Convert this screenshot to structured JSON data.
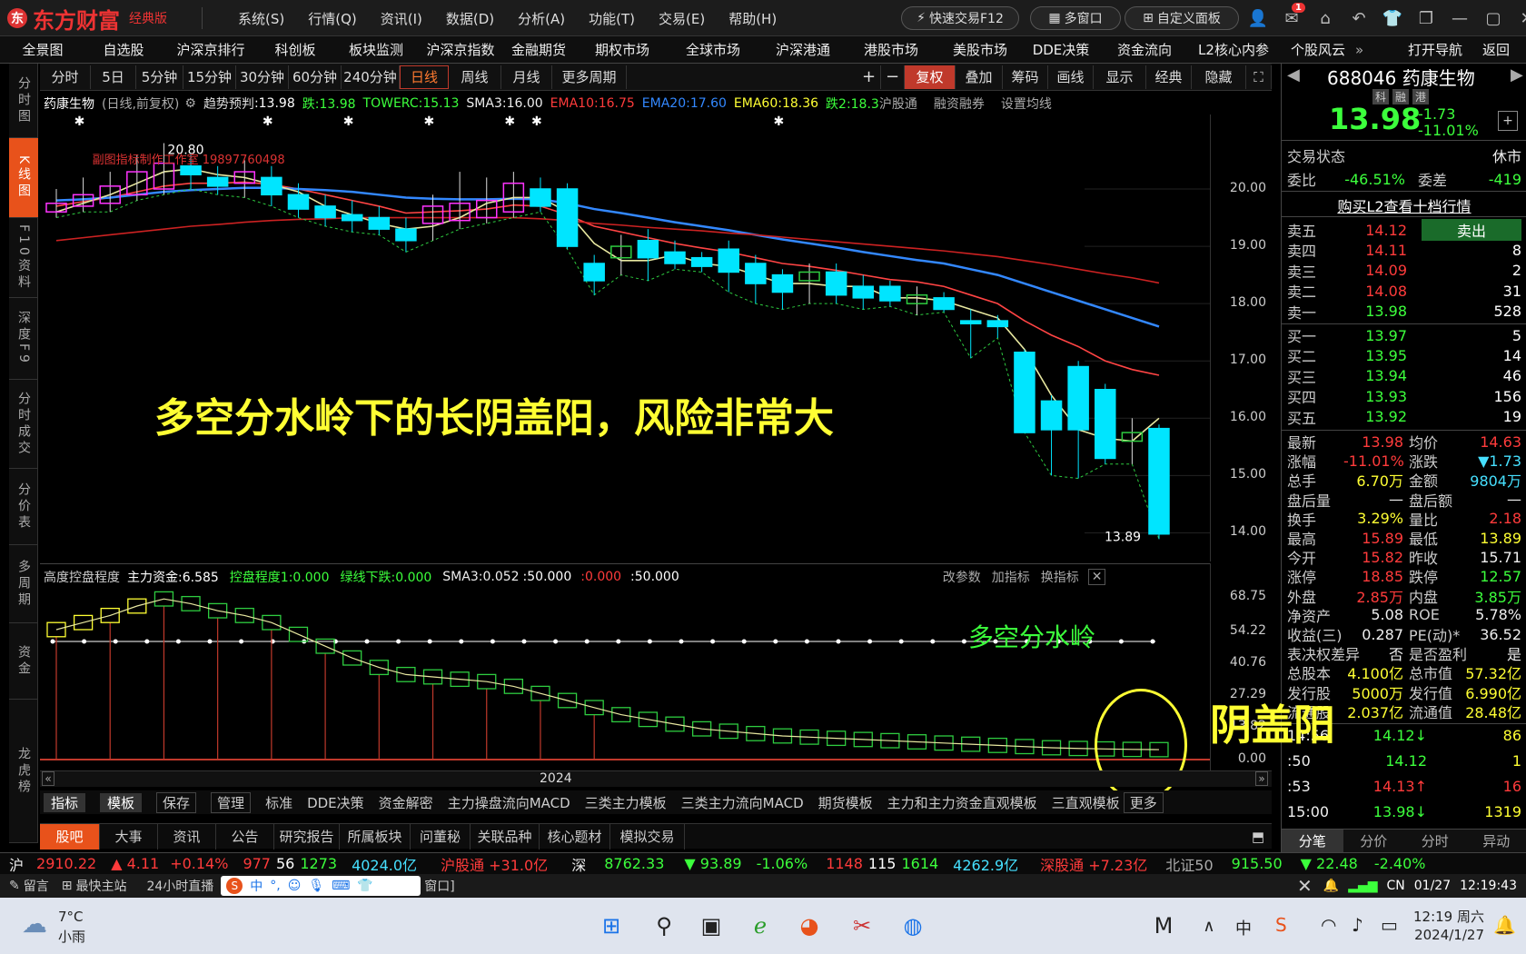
{
  "app": {
    "logo_text": "东方财富",
    "edition": "经典版"
  },
  "top_menu": [
    "系统(S)",
    "行情(Q)",
    "资讯(I)",
    "数据(D)",
    "分析(A)",
    "功能(T)",
    "交易(E)",
    "帮助(H)"
  ],
  "top_buttons": {
    "quick_trade": "快速交易F12",
    "multi_window": "多窗口",
    "custom_panel": "自定义面板"
  },
  "notification_count": "1",
  "nav": [
    "全景图",
    "自选股",
    "沪深京排行",
    "科创板",
    "板块监测",
    "沪深京指数",
    "金融期货",
    "期权市场",
    "全球市场",
    "沪深港通",
    "港股市场",
    "美股市场",
    "DDE决策",
    "资金流向",
    "L2核心内参",
    "个股风云"
  ],
  "nav_right": {
    "open_nav": "打开导航",
    "back": "返回"
  },
  "left_tabs": [
    {
      "label": "分时图",
      "active": false
    },
    {
      "label": "K线图",
      "active": true
    },
    {
      "label": "F10资料",
      "active": false
    },
    {
      "label": "深度F9",
      "active": false
    },
    {
      "label": "分时成交",
      "active": false
    },
    {
      "label": "分价表",
      "active": false
    },
    {
      "label": "多周期",
      "active": false
    },
    {
      "label": "资金",
      "active": false
    },
    {
      "label": "龙虎榜",
      "active": false
    }
  ],
  "period_tabs": [
    "分时",
    "5日",
    "5分钟",
    "15分钟",
    "30分钟",
    "60分钟",
    "240分钟",
    "日线",
    "周线",
    "月线",
    "更多周期"
  ],
  "period_active": "日线",
  "chart_tools": [
    "复权",
    "叠加",
    "筹码",
    "画线",
    "显示",
    "经典",
    "隐藏"
  ],
  "info_line": {
    "name": "药康生物",
    "mode": "(日线,前复权)",
    "trend": "趋势预判",
    "trend_val": ":13.98",
    "die": "跌:13.98",
    "towerc": "TOWERC:15.13",
    "sma3": "SMA3:16.00",
    "ema10": "EMA10:16.75",
    "ema20": "EMA20:17.60",
    "ema60": "EMA60:18.36",
    "die2": "跌2:18.3",
    "links": [
      "沪股通",
      "融资融券",
      "设置均线"
    ]
  },
  "annotation": "多空分水岭下的长阴盖阳，风险非常大",
  "chart_labels": {
    "high_mark": "20.80",
    "low_mark": "13.89",
    "watermark": "副图指标制作工作室 19897760498"
  },
  "y_axis_main": [
    "20.00",
    "19.00",
    "18.00",
    "17.00",
    "16.00",
    "15.00",
    "14.00"
  ],
  "sub_header": {
    "name": "高度控盘程度",
    "main_fund": "主力资金:6.585",
    "control": "控盘程度1:0.000",
    "green_down": "绿线下跌:0.000",
    "sma3": "SMA3:0.052",
    "v1": ":50.000",
    "v2": ":0.000",
    "v3": ":50.000",
    "btns": [
      "改参数",
      "加指标",
      "换指标"
    ]
  },
  "sub_annotation": "多空分水岭",
  "yin_label": "阴盖阳",
  "y_axis_sub": [
    "68.75",
    "54.22",
    "40.76",
    "27.29",
    "13.82",
    "0.00"
  ],
  "x_axis_label": "2024",
  "template_tabs": [
    "指标",
    "模板",
    "保存",
    "管理",
    "标准",
    "DDE决策",
    "资金解密",
    "主力操盘流向MACD",
    "三类主力模板",
    "三类主力流向MACD",
    "期货模板",
    "主力和主力资金直观模板",
    "三直观模板",
    "更多"
  ],
  "bottom_tabs": [
    "股吧",
    "大事",
    "资讯",
    "公告",
    "研究报告",
    "所属板块",
    "问董秘",
    "关联品种",
    "核心题材",
    "模拟交易"
  ],
  "quote": {
    "code": "688046",
    "name": "药康生物",
    "tags": [
      "科",
      "融",
      "港"
    ],
    "price": "13.98",
    "change": "-1.73",
    "pct": "-11.01%",
    "status_label": "交易状态",
    "status": "休市",
    "weibi_label": "委比",
    "weibi": "-46.51%",
    "weicha_label": "委差",
    "weicha": "-419",
    "l2_link": "购买L2查看十档行情"
  },
  "asks": [
    {
      "label": "卖五",
      "price": "14.12",
      "vol": "卖出"
    },
    {
      "label": "卖四",
      "price": "14.11",
      "vol": "8"
    },
    {
      "label": "卖三",
      "price": "14.09",
      "vol": "2"
    },
    {
      "label": "卖二",
      "price": "14.08",
      "vol": "31"
    },
    {
      "label": "卖一",
      "price": "13.98",
      "vol": "528"
    }
  ],
  "bids": [
    {
      "label": "买一",
      "price": "13.97",
      "vol": "5"
    },
    {
      "label": "买二",
      "price": "13.95",
      "vol": "14"
    },
    {
      "label": "买三",
      "price": "13.94",
      "vol": "46"
    },
    {
      "label": "买四",
      "price": "13.93",
      "vol": "156"
    },
    {
      "label": "买五",
      "price": "13.92",
      "vol": "19"
    }
  ],
  "stats": [
    [
      "最新",
      "13.98",
      "red",
      "均价",
      "14.63",
      "red"
    ],
    [
      "涨幅",
      "-11.01%",
      "red",
      "涨跌",
      "▼1.73",
      "cyan"
    ],
    [
      "总手",
      "6.70万",
      "yellow",
      "金额",
      "9804万",
      "cyan"
    ],
    [
      "盘后量",
      "—",
      "white",
      "盘后额",
      "—",
      "white"
    ],
    [
      "换手",
      "3.29%",
      "yellow",
      "量比",
      "2.18",
      "red"
    ],
    [
      "最高",
      "15.89",
      "red",
      "最低",
      "13.89",
      "yellow"
    ],
    [
      "今开",
      "15.82",
      "red",
      "昨收",
      "15.71",
      "white"
    ],
    [
      "涨停",
      "18.85",
      "red",
      "跌停",
      "12.57",
      "green"
    ],
    [
      "外盘",
      "2.85万",
      "red",
      "内盘",
      "3.85万",
      "green"
    ],
    [
      "净资产",
      "5.08",
      "white",
      "ROE",
      "5.78%",
      "white"
    ],
    [
      "收益(三)",
      "0.287",
      "white",
      "PE(动)*",
      "36.52",
      "white"
    ],
    [
      "表决权差异",
      "否",
      "white",
      "是否盈利",
      "是",
      "white"
    ],
    [
      "总股本",
      "4.100亿",
      "yellow",
      "总市值",
      "57.32亿",
      "yellow"
    ],
    [
      "发行股",
      "5000万",
      "yellow",
      "发行值",
      "6.990亿",
      "yellow"
    ],
    [
      "流通股",
      "2.037亿",
      "yellow",
      "流通值",
      "28.48亿",
      "yellow"
    ]
  ],
  "ticks": [
    {
      "time": "14:56",
      "price": "14.12↓",
      "vol": "86"
    },
    {
      "time": ":50",
      "price": "14.12",
      "vol": "1"
    },
    {
      "time": ":53",
      "price": "14.13↑",
      "vol": "16"
    },
    {
      "time": "15:00",
      "price": "13.98↓",
      "vol": "1319"
    }
  ],
  "right_bottom_tabs": [
    "分笔",
    "分价",
    "分时",
    "异动"
  ],
  "index_bar": {
    "sh": "沪",
    "sh_val": "2910.22",
    "sh_chg": "▲ 4.11",
    "sh_pct": "+0.14%",
    "sh_up": "977",
    "sh_flat": "56",
    "sh_down": "1273",
    "sh_amt": "4024.0亿",
    "hgt": "沪股通 +31.0亿",
    "sz": "深",
    "sz_val": "8762.33",
    "sz_chg": "▼ 93.89",
    "sz_pct": "-1.06%",
    "sz_up": "1148",
    "sz_flat": "115",
    "sz_down": "1614",
    "sz_amt": "4262.9亿",
    "sgt": "深股通 +7.23亿",
    "bz": "北证50",
    "bz_val": "915.50",
    "bz_chg": "▼ 22.48",
    "bz_pct": "-2.40%"
  },
  "status_bar": {
    "msg": "留言",
    "site": "最快主站",
    "news": "24小时直播",
    "input_hint": "窗口]",
    "lang": "CN",
    "date": "01/27",
    "time": "12:19:43"
  },
  "taskbar": {
    "weather_temp": "7°C",
    "weather_desc": "小雨",
    "clock_time": "12:19 周六",
    "clock_date": "2024/1/27",
    "tray_lang": "中"
  },
  "colors": {
    "accent": "#e8521b",
    "up": "#ff3b3b",
    "down": "#00e5ff",
    "bg": "#000000"
  },
  "chart_data": {
    "type": "candlestick",
    "title": "药康生物",
    "ylim": [
      13.5,
      21.3
    ],
    "candles": [
      [
        19.6,
        19.75,
        20.0,
        19.5
      ],
      [
        19.7,
        19.9,
        20.2,
        19.6
      ],
      [
        19.75,
        20.05,
        20.3,
        19.6
      ],
      [
        19.9,
        20.3,
        20.6,
        19.8
      ],
      [
        20.0,
        20.45,
        20.8,
        19.9
      ],
      [
        20.4,
        20.25,
        20.6,
        20.0
      ],
      [
        20.2,
        20.05,
        20.4,
        19.9
      ],
      [
        20.1,
        20.3,
        20.5,
        19.85
      ],
      [
        20.2,
        19.9,
        20.4,
        19.7
      ],
      [
        19.9,
        19.65,
        20.1,
        19.5
      ],
      [
        19.7,
        19.5,
        19.9,
        19.35
      ],
      [
        19.55,
        19.45,
        19.8,
        19.25
      ],
      [
        19.5,
        19.3,
        19.7,
        19.2
      ],
      [
        19.3,
        19.1,
        19.5,
        18.9
      ],
      [
        19.4,
        19.7,
        19.9,
        19.1
      ],
      [
        19.45,
        19.75,
        20.3,
        19.3
      ],
      [
        19.5,
        19.8,
        20.2,
        19.4
      ],
      [
        19.6,
        20.1,
        20.3,
        19.5
      ],
      [
        20.0,
        19.7,
        20.2,
        19.6
      ],
      [
        20.0,
        19.0,
        20.1,
        18.95
      ],
      [
        18.7,
        18.4,
        18.85,
        18.15
      ],
      [
        18.8,
        19.0,
        19.2,
        18.5
      ],
      [
        19.1,
        18.8,
        19.3,
        18.4
      ],
      [
        18.9,
        18.7,
        19.1,
        18.6
      ],
      [
        18.8,
        18.65,
        18.9,
        18.55
      ],
      [
        18.95,
        18.55,
        19.1,
        18.2
      ],
      [
        18.7,
        18.35,
        18.85,
        18.0
      ],
      [
        18.5,
        18.2,
        18.6,
        17.9
      ],
      [
        18.4,
        18.55,
        18.7,
        18.0
      ],
      [
        18.55,
        18.15,
        18.7,
        18.0
      ],
      [
        18.3,
        18.1,
        18.5,
        17.9
      ],
      [
        18.3,
        18.05,
        18.4,
        17.95
      ],
      [
        18.0,
        18.15,
        18.3,
        17.8
      ],
      [
        18.1,
        17.9,
        18.2,
        17.85
      ],
      [
        17.7,
        17.65,
        17.9,
        17.05
      ],
      [
        17.7,
        17.6,
        17.8,
        17.4
      ],
      [
        17.15,
        15.75,
        17.2,
        15.75
      ],
      [
        16.3,
        15.8,
        16.4,
        15.0
      ],
      [
        16.9,
        15.8,
        17.0,
        14.95
      ],
      [
        16.5,
        15.3,
        16.6,
        15.2
      ],
      [
        15.6,
        15.75,
        16.0,
        15.2
      ],
      [
        15.82,
        13.98,
        15.89,
        13.89
      ]
    ],
    "ema_series": [
      {
        "name": "EMA10",
        "color": "#ff4444",
        "values": [
          19.7,
          19.78,
          19.85,
          19.95,
          20.05,
          20.1,
          20.1,
          20.12,
          20.08,
          20.0,
          19.9,
          19.8,
          19.7,
          19.58,
          19.6,
          19.62,
          19.65,
          19.72,
          19.7,
          19.55,
          19.35,
          19.25,
          19.15,
          19.05,
          18.97,
          18.9,
          18.8,
          18.7,
          18.65,
          18.58,
          18.5,
          18.42,
          18.38,
          18.3,
          18.15,
          18.0,
          17.7,
          17.45,
          17.25,
          17.0,
          16.85,
          16.75
        ]
      },
      {
        "name": "EMA20",
        "color": "#3388ff",
        "values": [
          19.8,
          19.82,
          19.85,
          19.9,
          19.95,
          19.98,
          20.0,
          20.02,
          20.02,
          20.0,
          19.98,
          19.95,
          19.9,
          19.85,
          19.83,
          19.82,
          19.82,
          19.83,
          19.82,
          19.75,
          19.65,
          19.58,
          19.5,
          19.42,
          19.35,
          19.28,
          19.2,
          19.12,
          19.05,
          18.98,
          18.9,
          18.83,
          18.76,
          18.7,
          18.6,
          18.5,
          18.35,
          18.2,
          18.05,
          17.9,
          17.75,
          17.6
        ]
      },
      {
        "name": "EMA60",
        "color": "#cc2222",
        "values": [
          19.1,
          19.15,
          19.2,
          19.25,
          19.3,
          19.35,
          19.38,
          19.42,
          19.45,
          19.47,
          19.48,
          19.5,
          19.5,
          19.5,
          19.5,
          19.5,
          19.5,
          19.5,
          19.48,
          19.45,
          19.4,
          19.37,
          19.33,
          19.3,
          19.27,
          19.23,
          19.2,
          19.16,
          19.12,
          19.08,
          19.04,
          19.0,
          18.96,
          18.92,
          18.87,
          18.82,
          18.75,
          18.68,
          18.6,
          18.52,
          18.45,
          18.36
        ]
      },
      {
        "name": "SMA3",
        "color": "#e8e8a0",
        "values": [
          19.6,
          19.75,
          19.9,
          20.1,
          20.3,
          20.35,
          20.25,
          20.2,
          20.08,
          19.95,
          19.7,
          19.55,
          19.4,
          19.3,
          19.35,
          19.5,
          19.75,
          19.85,
          19.85,
          19.6,
          19.05,
          18.75,
          18.75,
          18.85,
          18.7,
          18.65,
          18.5,
          18.35,
          18.35,
          18.3,
          18.3,
          18.1,
          18.1,
          18.05,
          17.9,
          17.75,
          17.2,
          16.4,
          15.8,
          15.65,
          15.6,
          16.0
        ]
      }
    ],
    "sub_bars": [
      52,
      55,
      58,
      62,
      65,
      63,
      60,
      58,
      55,
      50,
      45,
      40,
      36,
      33,
      32,
      31,
      30,
      28,
      25,
      22,
      19,
      16,
      14,
      12,
      10,
      9,
      8,
      7,
      6.5,
      6,
      5.5,
      5,
      4.5,
      4,
      3.5,
      3,
      2.5,
      2,
      1.7,
      1.5,
      1.3,
      1.2
    ]
  }
}
